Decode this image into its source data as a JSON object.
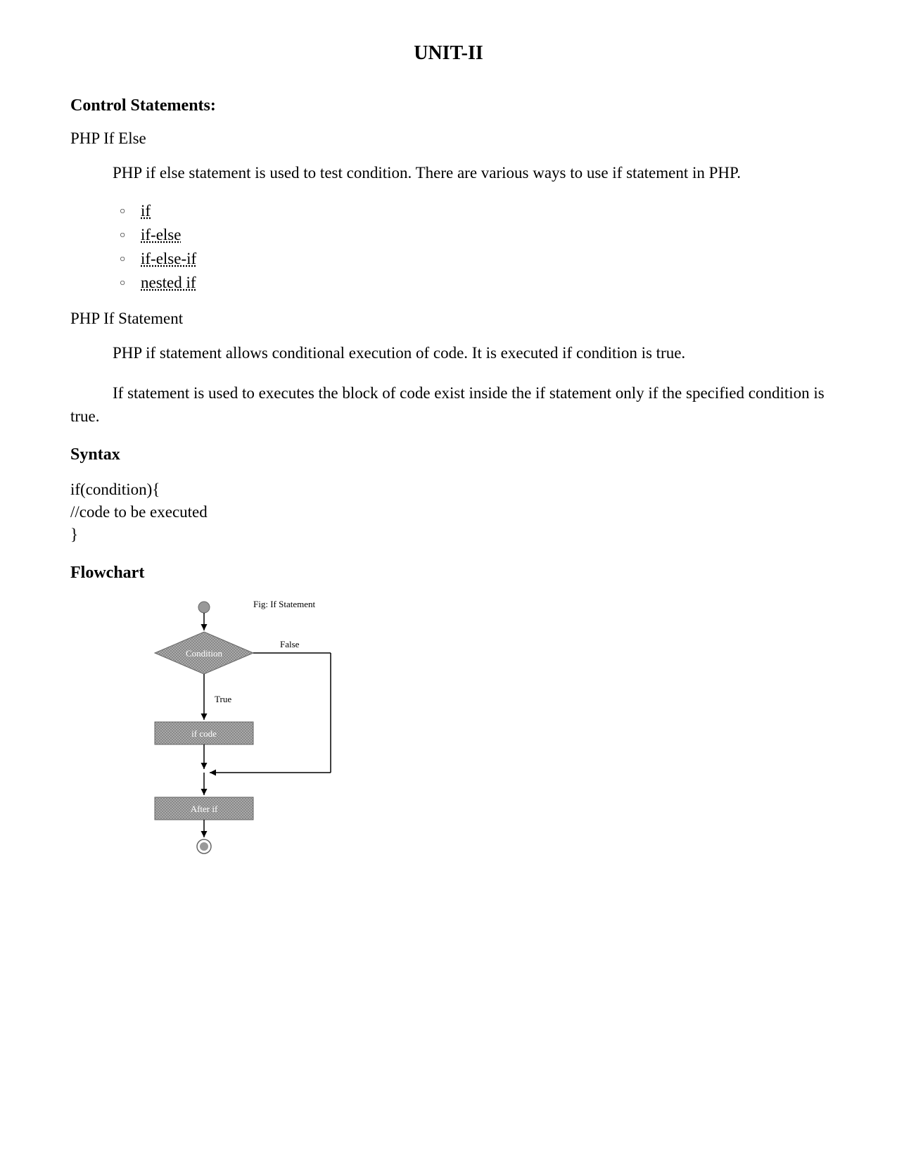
{
  "title": "UNIT-II",
  "section1": {
    "heading": "Control Statements:",
    "sub1": "PHP If Else",
    "para1": "PHP if else statement is used to test condition. There are various ways to use if statement in PHP.",
    "bullets": [
      "if",
      "if-else",
      "if-else-if",
      "nested if"
    ],
    "sub2": "PHP If Statement",
    "para2": "PHP if statement allows conditional execution of code. It is executed if condition is true.",
    "para3": "If statement is used to executes the block of code exist inside the if statement only if the specified condition is true."
  },
  "syntax": {
    "heading": "Syntax",
    "line1": "if(condition){",
    "line2": "//code to be executed",
    "line3": "}"
  },
  "flowchart": {
    "heading": "Flowchart",
    "figTitle": "Fig: If Statement",
    "condition": "Condition",
    "falseLabel": "False",
    "trueLabel": "True",
    "ifCode": "if code",
    "afterIf": "After if"
  }
}
